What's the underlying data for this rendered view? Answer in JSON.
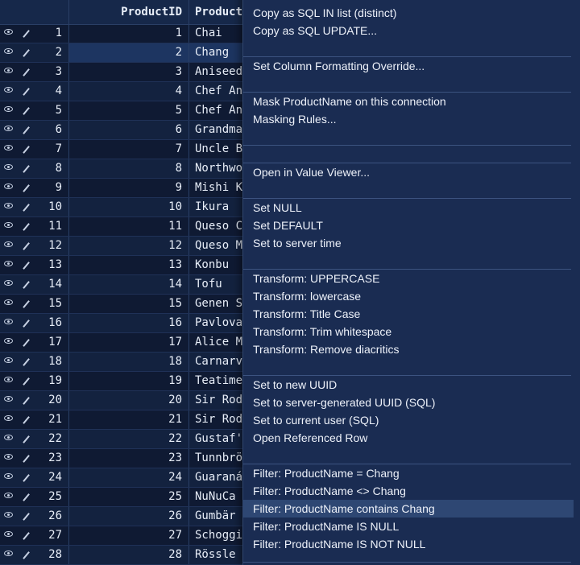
{
  "grid": {
    "columns": {
      "product_id": "ProductID",
      "product_name": "Product"
    },
    "rows": [
      {
        "num": "1",
        "id": "1",
        "name": "Chai"
      },
      {
        "num": "2",
        "id": "2",
        "name": "Chang"
      },
      {
        "num": "3",
        "id": "3",
        "name": "Aniseed"
      },
      {
        "num": "4",
        "id": "4",
        "name": "Chef An"
      },
      {
        "num": "5",
        "id": "5",
        "name": "Chef An"
      },
      {
        "num": "6",
        "id": "6",
        "name": "Grandma"
      },
      {
        "num": "7",
        "id": "7",
        "name": "Uncle B"
      },
      {
        "num": "8",
        "id": "8",
        "name": "Northwo"
      },
      {
        "num": "9",
        "id": "9",
        "name": "Mishi K"
      },
      {
        "num": "10",
        "id": "10",
        "name": "Ikura"
      },
      {
        "num": "11",
        "id": "11",
        "name": "Queso C"
      },
      {
        "num": "12",
        "id": "12",
        "name": "Queso M"
      },
      {
        "num": "13",
        "id": "13",
        "name": "Konbu"
      },
      {
        "num": "14",
        "id": "14",
        "name": "Tofu"
      },
      {
        "num": "15",
        "id": "15",
        "name": "Genen S"
      },
      {
        "num": "16",
        "id": "16",
        "name": "Pavlova"
      },
      {
        "num": "17",
        "id": "17",
        "name": "Alice M"
      },
      {
        "num": "18",
        "id": "18",
        "name": "Carnarv"
      },
      {
        "num": "19",
        "id": "19",
        "name": "Teatime"
      },
      {
        "num": "20",
        "id": "20",
        "name": "Sir Rod"
      },
      {
        "num": "21",
        "id": "21",
        "name": "Sir Rod"
      },
      {
        "num": "22",
        "id": "22",
        "name": "Gustaf'"
      },
      {
        "num": "23",
        "id": "23",
        "name": "Tunnbrö"
      },
      {
        "num": "24",
        "id": "24",
        "name": "Guaraná"
      },
      {
        "num": "25",
        "id": "25",
        "name": "NuNuCa"
      },
      {
        "num": "26",
        "id": "26",
        "name": "Gumbär"
      },
      {
        "num": "27",
        "id": "27",
        "name": "Schoggi"
      },
      {
        "num": "28",
        "id": "28",
        "name": "Rössle"
      }
    ]
  },
  "context_menu": {
    "items": [
      "Copy as SQL IN list (distinct)",
      "Copy as SQL UPDATE...",
      "Set Column Formatting Override...",
      "Mask ProductName on this connection",
      "Masking Rules...",
      "Open in Value Viewer...",
      "Set NULL",
      "Set DEFAULT",
      "Set to server time",
      "Transform: UPPERCASE",
      "Transform: lowercase",
      "Transform: Title Case",
      "Transform: Trim whitespace",
      "Transform: Remove diacritics",
      "Set to new UUID",
      "Set to server-generated UUID (SQL)",
      "Set to current user (SQL)",
      "Open Referenced Row",
      "Filter: ProductName = Chang",
      "Filter: ProductName <> Chang",
      "Filter: ProductName contains Chang",
      "Filter: ProductName IS NULL",
      "Filter: ProductName IS NOT NULL"
    ],
    "highlighted_item": "Filter: ProductName contains Chang"
  },
  "colors": {
    "background": "#0f1a33",
    "menu_background": "#1a2c52",
    "menu_highlight": "#2e4773",
    "text": "#e8eef8"
  }
}
